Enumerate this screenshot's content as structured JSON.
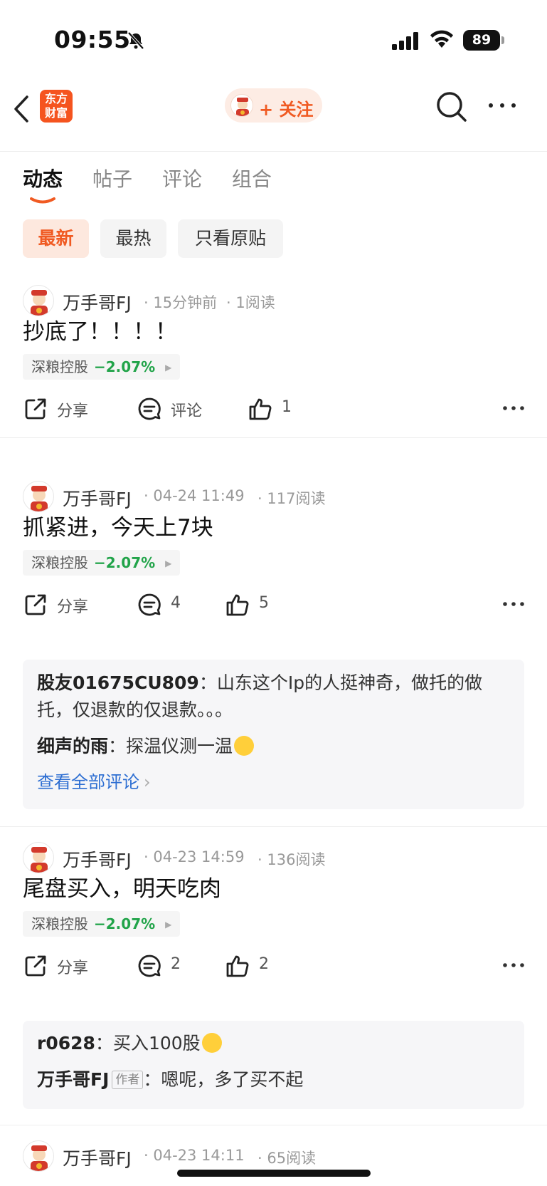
{
  "status": {
    "time": "09:55",
    "battery": "89"
  },
  "nav": {
    "logo_line1": "东方",
    "logo_line2": "财富",
    "follow_label": "+ 关注"
  },
  "tabs": [
    {
      "label": "动态",
      "active": true
    },
    {
      "label": "帖子",
      "active": false
    },
    {
      "label": "评论",
      "active": false
    },
    {
      "label": "组合",
      "active": false
    }
  ],
  "filters": [
    {
      "label": "最新",
      "active": true
    },
    {
      "label": "最热",
      "active": false
    },
    {
      "label": "只看原贴",
      "active": false
    }
  ],
  "posts": [
    {
      "author": "万手哥FJ",
      "time": "15分钟前",
      "reads": "1阅读",
      "text": "抄底了！！！！",
      "stock": {
        "name": "深粮控股",
        "change": "−2.07%"
      },
      "share_label": "分享",
      "comment_label": "评论",
      "like_count": "1"
    },
    {
      "author": "万手哥FJ",
      "time": "04-24 11:49",
      "reads": "117阅读",
      "text": "抓紧进，今天上7块",
      "stock": {
        "name": "深粮控股",
        "change": "−2.07%"
      },
      "share_label": "分享",
      "comment_label": "4",
      "like_count": "5",
      "comments": [
        {
          "who": "股友01675CU809",
          "sep": "：",
          "text": "山东这个Ip的人挺神奇，做托的做托，仅退款的仅退款。。。"
        },
        {
          "who": "细声的雨",
          "sep": "：",
          "text": "探温仪测一温"
        }
      ],
      "view_all": "查看全部评论"
    },
    {
      "author": "万手哥FJ",
      "time": "04-23 14:59",
      "reads": "136阅读",
      "text": "尾盘买入，明天吃肉",
      "stock": {
        "name": "深粮控股",
        "change": "−2.07%"
      },
      "share_label": "分享",
      "comment_label": "2",
      "like_count": "2",
      "comments": [
        {
          "who": "r0628",
          "sep": "：",
          "text": "买入100股"
        },
        {
          "who": "万手哥FJ",
          "badge": "作者",
          "sep": "：",
          "text": "嗯呢，多了买不起"
        }
      ]
    },
    {
      "author": "万手哥FJ",
      "time": "04-23 14:11",
      "reads": "65阅读"
    }
  ],
  "colors": {
    "accent": "#f05a22",
    "down_green": "#22a44a",
    "link_blue": "#2d6ed2"
  }
}
